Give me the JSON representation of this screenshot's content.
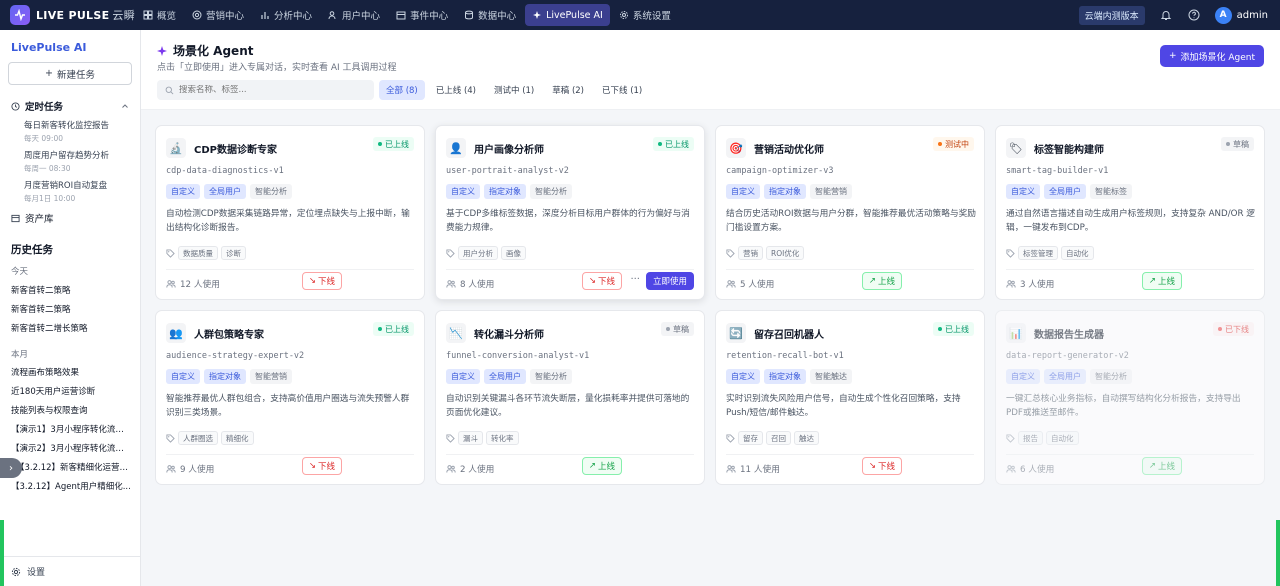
{
  "app": {
    "name": "LIVE PULSE",
    "name_sub": "云瞬",
    "env_badge": "云端内测版本",
    "user": "admin",
    "avatar_letter": "A"
  },
  "nav": [
    {
      "label": "概览",
      "icon": "grid-icon"
    },
    {
      "label": "营销中心",
      "icon": "target-icon"
    },
    {
      "label": "分析中心",
      "icon": "bar-chart-icon"
    },
    {
      "label": "用户中心",
      "icon": "users-icon"
    },
    {
      "label": "事件中心",
      "icon": "calendar-icon"
    },
    {
      "label": "数据中心",
      "icon": "database-icon"
    },
    {
      "label": "LivePulse AI",
      "icon": "sparkle-icon",
      "active": true
    },
    {
      "label": "系统设置",
      "icon": "gear-icon"
    }
  ],
  "sidebar": {
    "title": "LivePulse AI",
    "new_task": "新建任务",
    "scheduled_label": "定时任务",
    "scheduled": [
      {
        "name": "每日新客转化监控报告",
        "meta": "每天 09:00"
      },
      {
        "name": "周度用户留存趋势分析",
        "meta": "每周一 08:30"
      },
      {
        "name": "月度营销ROI自动复盘",
        "meta": "每月1日 10:00"
      }
    ],
    "assets_label": "资产库",
    "history_title": "历史任务",
    "group_today": "今天",
    "today": [
      "新客首转二策略",
      "新客首转二策略",
      "新客首转二增长策略"
    ],
    "group_month": "本月",
    "month": [
      "流程画布策略效果",
      "近180天用户运营诊断",
      "技能列表与权限查询",
      "【演示1】3月小程序转化流失...",
      "【演示2】3月小程序转化流失...",
      "【3.2.12】新客精细化运营策略",
      "【3.2.12】Agent用户精细化..."
    ],
    "settings": "设置"
  },
  "header": {
    "title": "场景化 Agent",
    "subtitle": "点击「立即使用」进入专属对话，实时查看 AI 工具调用过程",
    "add_button": "添加场景化 Agent",
    "search_placeholder": "搜索名称、标签..."
  },
  "filters": [
    {
      "label": "全部 (8)",
      "active": true
    },
    {
      "label": "已上线 (4)"
    },
    {
      "label": "测试中 (1)"
    },
    {
      "label": "草稿 (2)"
    },
    {
      "label": "已下线 (1)"
    }
  ],
  "labels": {
    "offline_btn": "下线",
    "online_btn": "上线",
    "use_btn": "立即使用",
    "more": "···"
  },
  "cards": [
    {
      "name": "CDP数据诊断专家",
      "id": "cdp-data-diagnostics-v1",
      "status": "已上线",
      "status_type": "online",
      "icon": "🔬",
      "chips": [
        "自定义",
        "全局用户",
        "智能分析"
      ],
      "desc": "自动检测CDP数据采集链路异常，定位埋点缺失与上报中断，输出结构化诊断报告。",
      "tags": [
        "数据质量",
        "诊断"
      ],
      "users": "12 人使用",
      "action": "下线"
    },
    {
      "name": "用户画像分析师",
      "id": "user-portrait-analyst-v2",
      "status": "已上线",
      "status_type": "online",
      "icon": "👤",
      "chips": [
        "自定义",
        "指定对象",
        "智能分析"
      ],
      "desc": "基于CDP多维标签数据，深度分析目标用户群体的行为偏好与消费能力规律。",
      "tags": [
        "用户分析",
        "画像"
      ],
      "users": "8 人使用",
      "action": "下线"
    },
    {
      "name": "营销活动优化师",
      "id": "campaign-optimizer-v3",
      "status": "测试中",
      "status_type": "testing",
      "icon": "🎯",
      "chips": [
        "自定义",
        "指定对象",
        "智能营销"
      ],
      "desc": "结合历史活动ROI数据与用户分群，智能推荐最优活动策略与奖励门槛设置方案。",
      "tags": [
        "营销",
        "ROI优化"
      ],
      "users": "5 人使用",
      "action": "上线"
    },
    {
      "name": "标签智能构建师",
      "id": "smart-tag-builder-v1",
      "status": "草稿",
      "status_type": "draft",
      "icon": "🏷",
      "chips": [
        "自定义",
        "全局用户",
        "智能标签"
      ],
      "desc": "通过自然语言描述自动生成用户标签规则，支持复杂 AND/OR 逻辑，一键发布到CDP。",
      "tags": [
        "标签管理",
        "自动化"
      ],
      "users": "3 人使用",
      "action": "上线"
    },
    {
      "name": "人群包策略专家",
      "id": "audience-strategy-expert-v2",
      "status": "已上线",
      "status_type": "online",
      "icon": "👥",
      "chips": [
        "自定义",
        "指定对象",
        "智能营销"
      ],
      "desc": "智能推荐最优人群包组合，支持高价值用户圈选与流失预警人群识别三类场景。",
      "tags": [
        "人群圈选",
        "精细化"
      ],
      "users": "9 人使用",
      "action": "下线"
    },
    {
      "name": "转化漏斗分析师",
      "id": "funnel-conversion-analyst-v1",
      "status": "草稿",
      "status_type": "draft",
      "icon": "📉",
      "chips": [
        "自定义",
        "全局用户",
        "智能分析"
      ],
      "desc": "自动识别关键漏斗各环节流失断层，量化损耗率并提供可落地的页面优化建议。",
      "tags": [
        "漏斗",
        "转化率"
      ],
      "users": "2 人使用",
      "action": "上线"
    },
    {
      "name": "留存召回机器人",
      "id": "retention-recall-bot-v1",
      "status": "已上线",
      "status_type": "online",
      "icon": "🔄",
      "chips": [
        "自定义",
        "指定对象",
        "智能触达"
      ],
      "desc": "实时识别流失风险用户信号，自动生成个性化召回策略，支持Push/短信/邮件触达。",
      "tags": [
        "留存",
        "召回",
        "触达"
      ],
      "users": "11 人使用",
      "action": "下线"
    },
    {
      "name": "数据报告生成器",
      "id": "data-report-generator-v2",
      "status": "已下线",
      "status_type": "offline",
      "icon": "📊",
      "chips": [
        "自定义",
        "全局用户",
        "智能分析"
      ],
      "desc": "一键汇总核心业务指标，自动撰写结构化分析报告，支持导出PDF或推送至邮件。",
      "tags": [
        "报告",
        "自动化"
      ],
      "users": "6 人使用",
      "action": "上线"
    }
  ]
}
